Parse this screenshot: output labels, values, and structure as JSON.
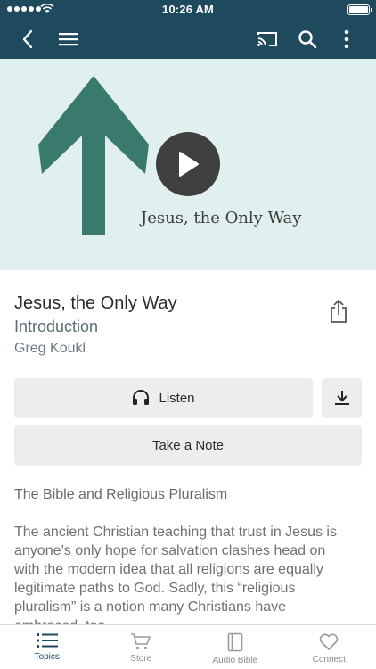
{
  "status_bar": {
    "time": "10:26 AM"
  },
  "app_bar": {
    "back_icon": "chevron-left-icon",
    "menu_icon": "hamburger-menu-icon",
    "cast_icon": "cast-icon",
    "search_icon": "search-icon",
    "more_icon": "more-vertical-icon",
    "color": "#1f4a5e"
  },
  "hero": {
    "artwork_title": "Jesus, the Only Way",
    "background": "#dff0ee",
    "arrow_color": "#3a7a6d",
    "play_icon": "play-icon"
  },
  "episode": {
    "title": "Jesus, the Only Way",
    "subtitle": "Introduction",
    "author": "Greg Koukl",
    "share_icon": "share-icon"
  },
  "actions": {
    "listen_label": "Listen",
    "listen_icon": "headphones-icon",
    "download_icon": "download-icon",
    "note_label": "Take a Note"
  },
  "content": {
    "section_title": "The Bible and Religious Pluralism",
    "description": "The ancient Christian teaching that trust in Jesus is anyone’s only hope for salvation clashes head on with the modern idea that all religions are equally legitimate paths to God. Sadly, this “religious pluralism” is a notion many Christians have embraced, too."
  },
  "tabs": [
    {
      "label": "Topics",
      "icon": "list-icon",
      "active": true
    },
    {
      "label": "Store",
      "icon": "cart-icon",
      "active": false
    },
    {
      "label": "Audio Bible",
      "icon": "book-icon",
      "active": false
    },
    {
      "label": "Connect",
      "icon": "heart-icon",
      "active": false
    }
  ]
}
